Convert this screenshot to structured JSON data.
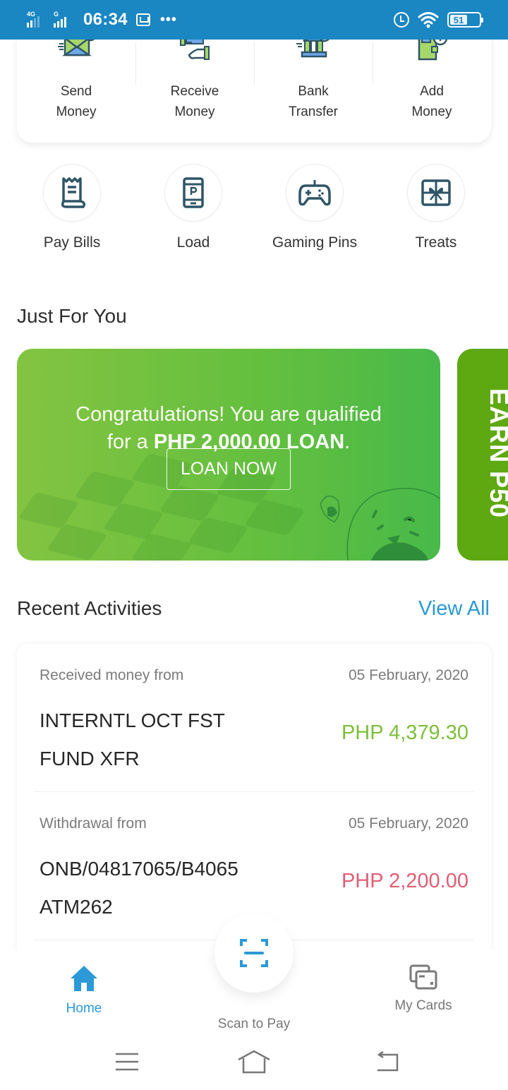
{
  "status_bar": {
    "network_1": "4G",
    "network_2": "G",
    "time": "06:34",
    "overflow": "•••",
    "battery": "51",
    "icons": [
      "signal-icon",
      "mail-icon",
      "alarm-icon",
      "wifi-icon",
      "battery-icon"
    ]
  },
  "quick_actions": [
    {
      "line1": "Send",
      "line2": "Money",
      "icon": "send-money-icon"
    },
    {
      "line1": "Receive",
      "line2": "Money",
      "icon": "receive-money-icon"
    },
    {
      "line1": "Bank",
      "line2": "Transfer",
      "icon": "bank-transfer-icon"
    },
    {
      "line1": "Add",
      "line2": "Money",
      "icon": "add-money-icon"
    }
  ],
  "services": [
    {
      "label": "Pay Bills",
      "icon": "receipt-icon"
    },
    {
      "label": "Load",
      "icon": "phone-load-icon"
    },
    {
      "label": "Gaming Pins",
      "icon": "gamepad-icon"
    },
    {
      "label": "Treats",
      "icon": "gift-icon"
    }
  ],
  "just_for_you": {
    "title": "Just For You",
    "promo": {
      "line1": "Congratulations! You are qualified",
      "line2_prefix": "for a ",
      "line2_bold": "PHP 2,000.00 LOAN",
      "line2_suffix": ".",
      "button": "LOAN NOW"
    },
    "promo2_text": "EARN P50"
  },
  "recent_activities": {
    "title": "Recent Activities",
    "view_all": "View All",
    "items": [
      {
        "type": "Received money from",
        "date": "05 February, 2020",
        "name_line1": "INTERNTL OCT FST",
        "name_line2": "FUND XFR",
        "amount": "PHP 4,379.30",
        "direction": "credit"
      },
      {
        "type": "Withdrawal from",
        "date": "05 February, 2020",
        "name_line1": "ONB/04817065/B4065",
        "name_line2": "ATM262",
        "amount": "PHP 2,200.00",
        "direction": "debit"
      }
    ]
  },
  "bottom_nav": {
    "items": [
      {
        "label": "Home",
        "active": true
      },
      {
        "label": "Scan to Pay",
        "active": false
      },
      {
        "label": "My Cards",
        "active": false
      }
    ]
  },
  "colors": {
    "status_bar": "#1a86c2",
    "accent_blue": "#2b9ad6",
    "credit_green": "#7cbf3a",
    "debit_red": "#e35d74",
    "icon_dark": "#2e5566",
    "promo_green": "#63bf3f",
    "promo2_green": "#5ea812"
  }
}
